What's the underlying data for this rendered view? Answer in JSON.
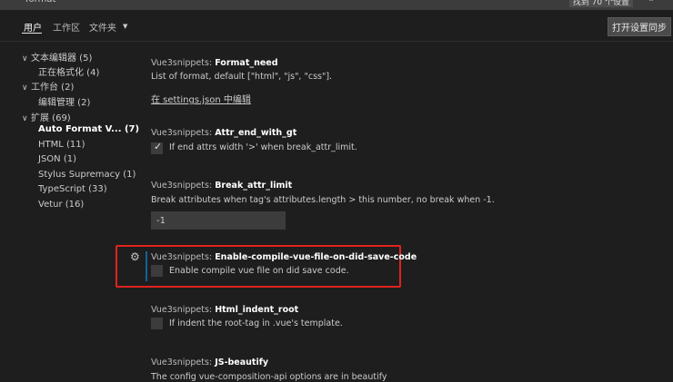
{
  "search": {
    "value": "format",
    "result_count": "找到 70 个设置",
    "clear_icon": "clear-filter-icon"
  },
  "tabs": [
    {
      "label": "用户",
      "active": true
    },
    {
      "label": "工作区",
      "active": false
    },
    {
      "label": "文件夹",
      "active": false
    }
  ],
  "sync_button": "打开设置同步",
  "tree": [
    {
      "label": "文本编辑器 (5)",
      "expanded": true
    },
    {
      "label": "正在格式化 (4)"
    },
    {
      "label": "工作台 (2)",
      "expanded": true
    },
    {
      "label": "编辑管理 (2)"
    },
    {
      "label": "扩展 (69)",
      "expanded": true
    },
    {
      "label": "Auto Format V...",
      "count": "(7)"
    },
    {
      "label": "HTML (11)"
    },
    {
      "label": "JSON (1)"
    },
    {
      "label": "Stylus Supremacy (1)"
    },
    {
      "label": "TypeScript (33)"
    },
    {
      "label": "Vetur (16)"
    }
  ],
  "settings": [
    {
      "category": "Vue3snippets: ",
      "key": "Format_need",
      "description": "List of format, default [\"html\", \"js\", \"css\"].",
      "link": "在 settings.json 中编辑"
    },
    {
      "category": "Vue3snippets: ",
      "key": "Attr_end_with_gt",
      "checked": true,
      "checkbox_label": "If end attrs width '>' when break_attr_limit."
    },
    {
      "category": "Vue3snippets: ",
      "key": "Break_attr_limit",
      "description": "Break attributes when tag's attributes.length > this number, no break when -1.",
      "value": "-1"
    },
    {
      "category": "Vue3snippets: ",
      "key": "Enable-compile-vue-file-on-did-save-code",
      "checked": false,
      "checkbox_label": "Enable compile vue file on did save code.",
      "highlighted": true
    },
    {
      "category": "Vue3snippets: ",
      "key": "Html_indent_root",
      "checked": false,
      "checkbox_label": "If indent the root-tag in .vue's template."
    },
    {
      "category": "Vue3snippets: ",
      "key": "JS-beautify",
      "description": "The config vue-composition-api options are in beautify"
    }
  ],
  "colors": {
    "background": "#1e1e1e",
    "highlight": "#e0231e",
    "focus": "#0e639c"
  }
}
